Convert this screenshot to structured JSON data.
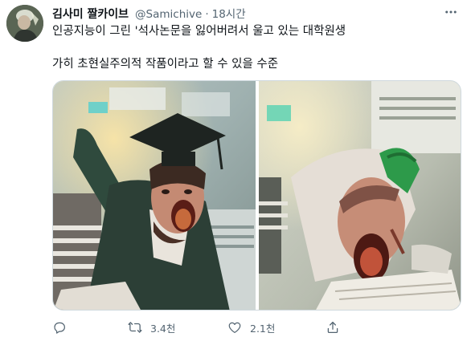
{
  "tweet": {
    "display_name": "김사미 짤카이브",
    "handle": "@Samichive",
    "separator": "·",
    "time": "18시간",
    "text_line1": "인공지능이 그린 '석사논문을 잃어버려서 울고 있는 대학원생",
    "text_line2": "가히 초현실주의적 작품이라고 할 수 있을 수준",
    "media": {
      "left_image": "AI-generated illustration of a screaming graduate student in a mortarboard cap",
      "right_image": "AI-generated illustration of a screaming student with green hair slumped over papers"
    }
  },
  "actions": {
    "reply": {
      "icon": "reply-icon",
      "count": ""
    },
    "retweet": {
      "icon": "retweet-icon",
      "count": "3.4천"
    },
    "like": {
      "icon": "heart-icon",
      "count": "2.1천"
    },
    "share": {
      "icon": "share-icon",
      "count": ""
    }
  },
  "colors": {
    "text": "#0f1419",
    "secondary": "#536471",
    "border": "#cfd9de"
  }
}
